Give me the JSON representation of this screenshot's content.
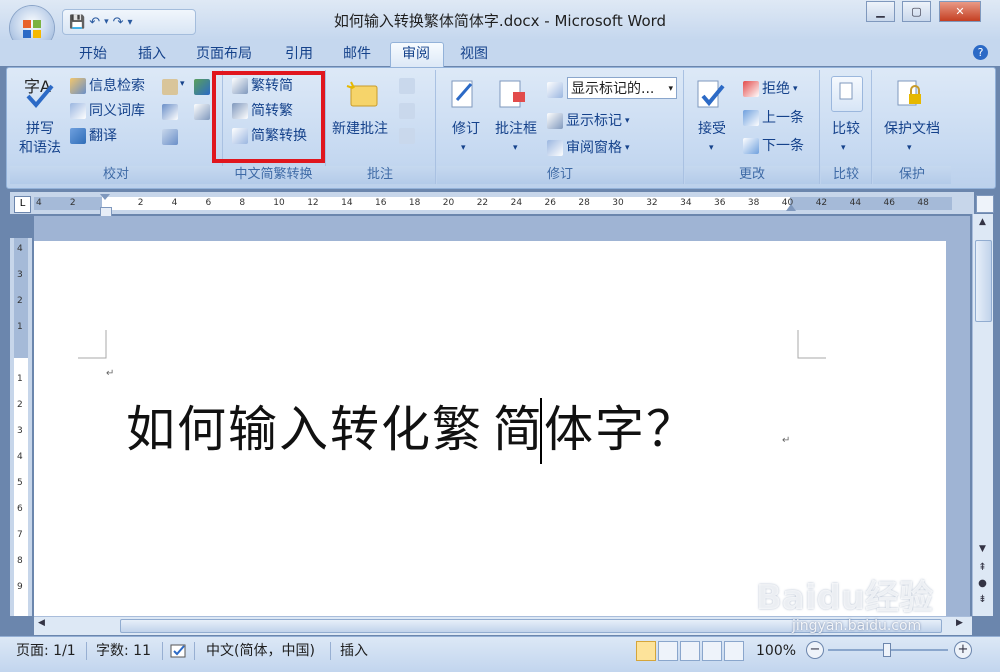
{
  "window": {
    "title": "如何输入转换繁体简体字.docx - Microsoft Word",
    "minimize": "▁",
    "maximize": "▢",
    "close": "✕"
  },
  "qat": {
    "save_icon": "save-icon",
    "undo_icon": "undo-icon",
    "redo_icon": "redo-icon",
    "customize_icon": "dropdown-icon"
  },
  "tabs": [
    "开始",
    "插入",
    "页面布局",
    "引用",
    "邮件",
    "审阅",
    "视图"
  ],
  "active_tab": "审阅",
  "ribbon": {
    "proofing": {
      "title": "校对",
      "spelling_line1": "拼写",
      "spelling_line2": "和语法",
      "research": "信息检索",
      "thesaurus": "同义词库",
      "translate": "翻译"
    },
    "chinese_conversion": {
      "title": "中文简繁转换",
      "trad_to_simp": "繁转简",
      "simp_to_trad": "简转繁",
      "conversion": "简繁转换"
    },
    "comments": {
      "title": "批注",
      "new_comment": "新建批注"
    },
    "tracking": {
      "title": "修订",
      "track_changes": "修订",
      "balloons": "批注框",
      "display_select": "显示标记的...",
      "show_markup": "显示标记",
      "reviewing_pane": "审阅窗格"
    },
    "changes": {
      "title": "更改",
      "accept": "接受",
      "reject": "拒绝",
      "previous": "上一条",
      "next": "下一条"
    },
    "compare": {
      "title": "比较",
      "compare": "比较"
    },
    "protect": {
      "title": "保护",
      "protect_document": "保护文档"
    }
  },
  "ruler": {
    "ticks": [
      "4",
      "2",
      "",
      "2",
      "4",
      "6",
      "8",
      "10",
      "12",
      "14",
      "16",
      "18",
      "20",
      "22",
      "24",
      "26",
      "28",
      "30",
      "32",
      "34",
      "36",
      "38",
      "40",
      "42",
      "44",
      "46",
      "48"
    ],
    "vticks": [
      "4",
      "3",
      "2",
      "1",
      "",
      "1",
      "2",
      "3",
      "4",
      "5",
      "6",
      "7",
      "8",
      "9"
    ]
  },
  "document": {
    "text_before_caret": "如何输入转化繁",
    "text_after_caret": "简体字？",
    "para_mark": "↵"
  },
  "statusbar": {
    "page": "页面: 1/1",
    "words": "字数: 11",
    "language": "中文(简体，中国)",
    "mode": "插入",
    "zoom": "100%"
  },
  "watermark": {
    "brand": "Baidu经验",
    "url": "jingyan.baidu.com"
  },
  "colors": {
    "highlight": "#e0161e",
    "ribbon": "#c6d9f1",
    "text": "#15428b"
  }
}
